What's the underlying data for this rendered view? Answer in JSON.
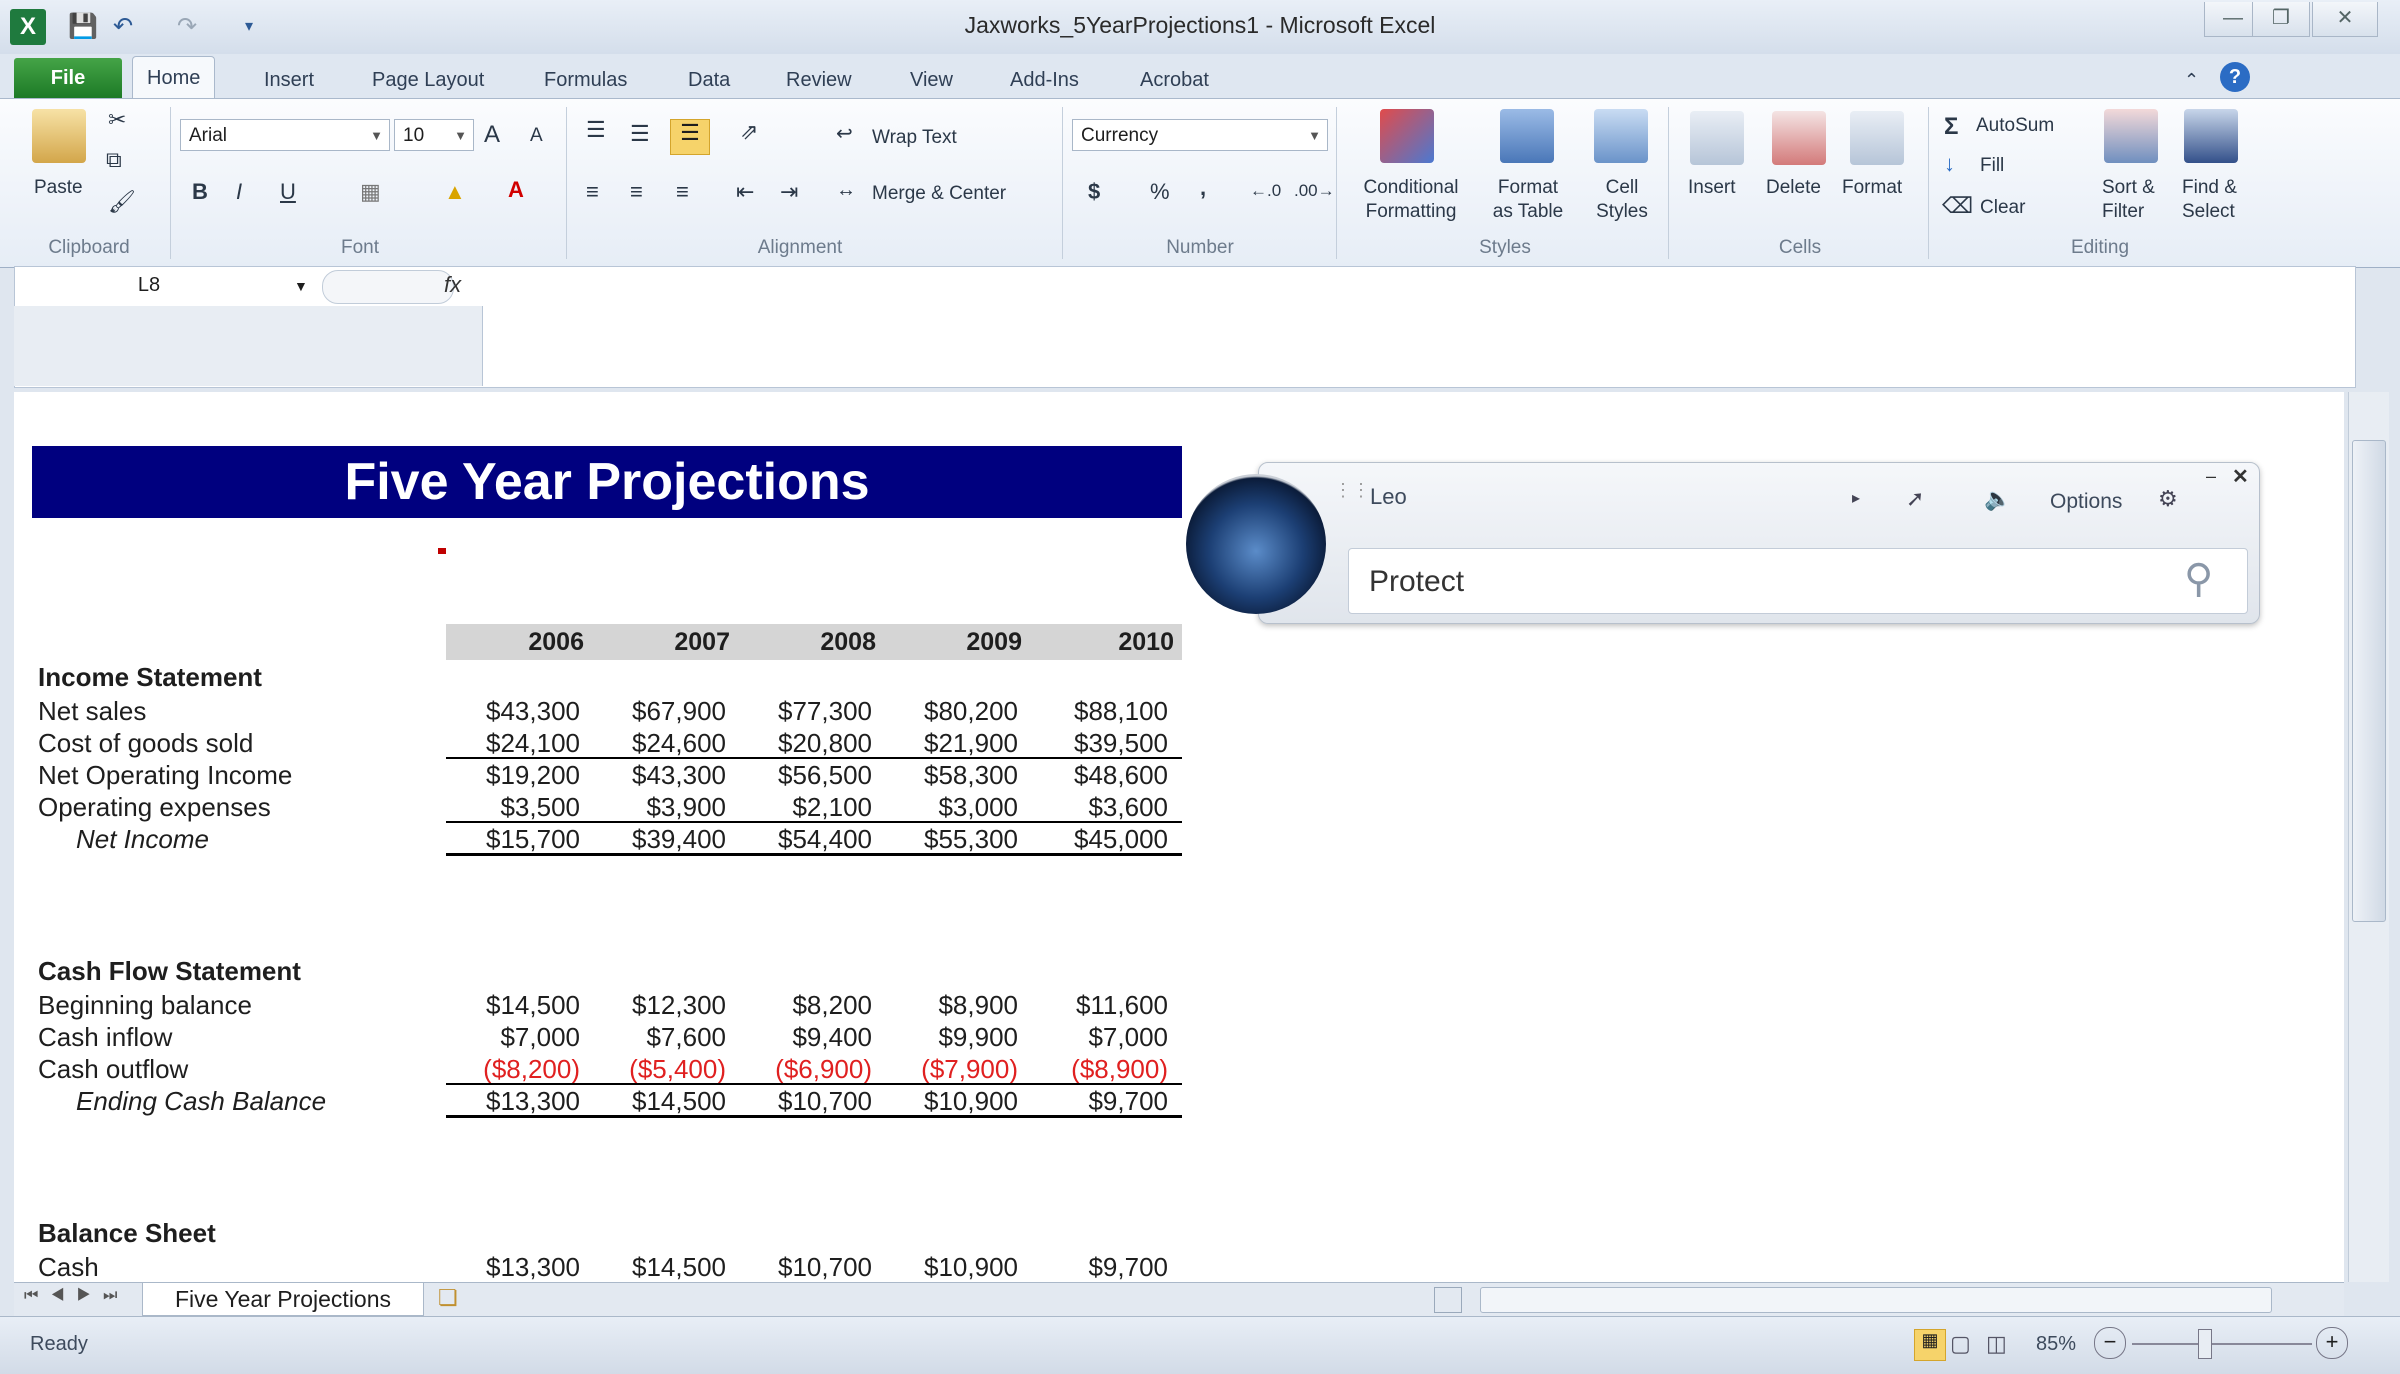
{
  "window": {
    "title": "Jaxworks_5YearProjections1  -  Microsoft Excel"
  },
  "tabs": [
    "File",
    "Home",
    "Insert",
    "Page Layout",
    "Formulas",
    "Data",
    "Review",
    "View",
    "Add-Ins",
    "Acrobat"
  ],
  "ribbon": {
    "clipboard": {
      "label": "Clipboard",
      "paste": "Paste"
    },
    "font": {
      "label": "Font",
      "name": "Arial",
      "size": "10",
      "bold": "B",
      "italic": "I",
      "underline": "U",
      "grow": "A",
      "shrink": "A"
    },
    "alignment": {
      "label": "Alignment",
      "wrap": "Wrap Text",
      "merge": "Merge & Center"
    },
    "number": {
      "label": "Number",
      "format": "Currency",
      "currency": "$",
      "percent": "%",
      "comma": ","
    },
    "styles": {
      "label": "Styles",
      "cond1": "Conditional",
      "cond2": "Formatting",
      "fmt1": "Format",
      "fmt2": "as Table",
      "cell1": "Cell",
      "cell2": "Styles"
    },
    "cells": {
      "label": "Cells",
      "insert": "Insert",
      "delete": "Delete",
      "format": "Format"
    },
    "editing": {
      "label": "Editing",
      "autosum": "AutoSum",
      "fill": "Fill",
      "clear": "Clear",
      "sort1": "Sort &",
      "sort2": "Filter",
      "find1": "Find &",
      "find2": "Select"
    }
  },
  "formula_bar": {
    "name_box": "L8",
    "fx": "fx"
  },
  "sheet": {
    "banner": "Five Year Projections",
    "years": [
      "2006",
      "2007",
      "2008",
      "2009",
      "2010"
    ],
    "income": {
      "title": "Income Statement",
      "rows": [
        {
          "label": "Net sales",
          "values": [
            "$43,300",
            "$67,900",
            "$77,300",
            "$80,200",
            "$88,100"
          ]
        },
        {
          "label": "Cost of goods sold",
          "values": [
            "$24,100",
            "$24,600",
            "$20,800",
            "$21,900",
            "$39,500"
          ]
        },
        {
          "label": "Net Operating Income",
          "values": [
            "$19,200",
            "$43,300",
            "$56,500",
            "$58,300",
            "$48,600"
          ]
        },
        {
          "label": "Operating expenses",
          "values": [
            "$3,500",
            "$3,900",
            "$2,100",
            "$3,000",
            "$3,600"
          ]
        },
        {
          "label": "Net Income",
          "values": [
            "$15,700",
            "$39,400",
            "$54,400",
            "$55,300",
            "$45,000"
          ]
        }
      ]
    },
    "cash": {
      "title": "Cash Flow Statement",
      "rows": [
        {
          "label": "Beginning balance",
          "values": [
            "$14,500",
            "$12,300",
            "$8,200",
            "$8,900",
            "$11,600"
          ]
        },
        {
          "label": "Cash inflow",
          "values": [
            "$7,000",
            "$7,600",
            "$9,400",
            "$9,900",
            "$7,000"
          ]
        },
        {
          "label": "Cash outflow",
          "values": [
            "($8,200)",
            "($5,400)",
            "($6,900)",
            "($7,900)",
            "($8,900)"
          ]
        },
        {
          "label": "Ending Cash Balance",
          "values": [
            "$13,300",
            "$14,500",
            "$10,700",
            "$10,900",
            "$9,700"
          ]
        }
      ]
    },
    "balance": {
      "title": "Balance Sheet",
      "rows": [
        {
          "label": "Cash",
          "values": [
            "$13,300",
            "$14,500",
            "$10,700",
            "$10,900",
            "$9,700"
          ]
        }
      ]
    }
  },
  "leo": {
    "name": "Leo",
    "options": "Options",
    "query": "Protect"
  },
  "sheet_tab": "Five Year Projections",
  "status": {
    "ready": "Ready",
    "zoom": "85%"
  },
  "colors": {
    "banner": "#00007f",
    "negative": "#e02020",
    "file_tab": "#2e8f36"
  }
}
